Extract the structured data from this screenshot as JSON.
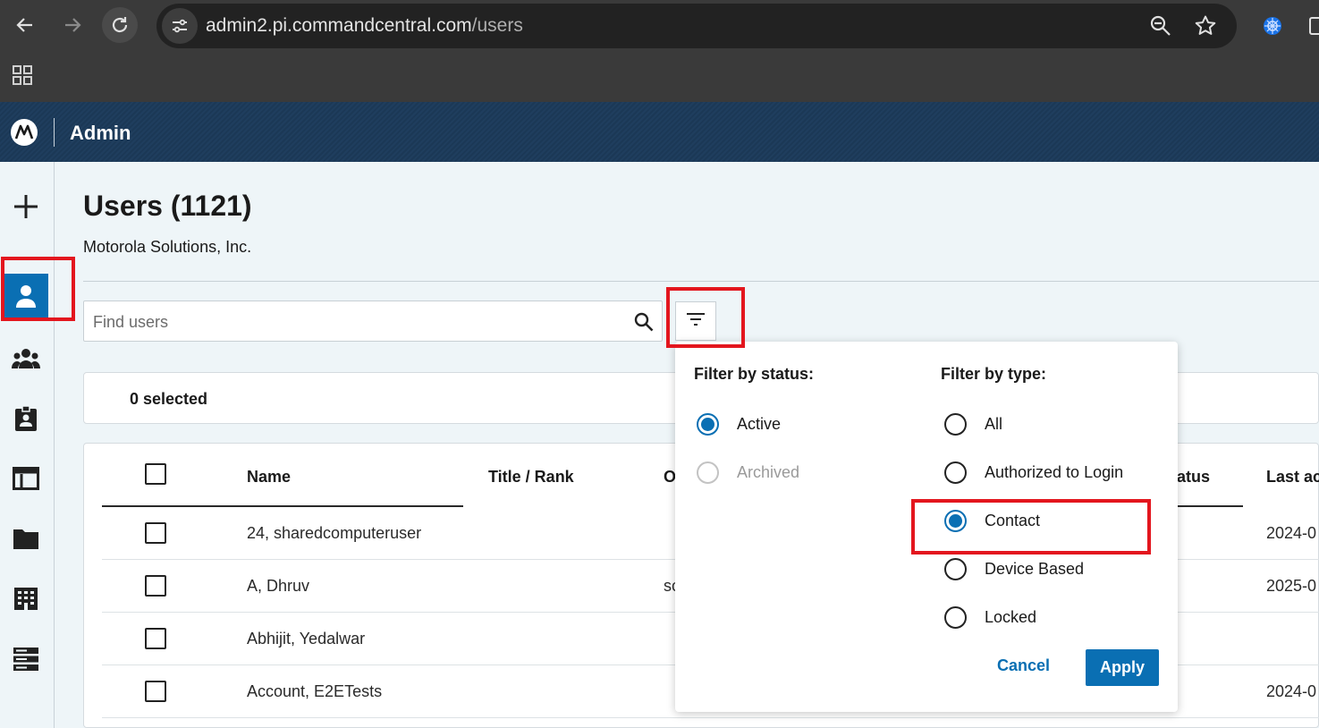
{
  "browser": {
    "url_host": "admin2.pi.commandcentral.com",
    "url_path": "/users"
  },
  "app": {
    "title": "Admin"
  },
  "page": {
    "title": "Users (1121)",
    "organization": "Motorola Solutions, Inc."
  },
  "search": {
    "placeholder": "Find users",
    "value": ""
  },
  "selection": {
    "count_label": "0 selected"
  },
  "table": {
    "headers": {
      "name": "Name",
      "title_rank": "Title / Rank",
      "o": "O",
      "status": "tatus",
      "last": "Last ac"
    },
    "rows": [
      {
        "name": "24, sharedcomputeruser",
        "o": "",
        "last": "2024-0"
      },
      {
        "name": "A, Dhruv",
        "o": "sc",
        "last": "2025-0"
      },
      {
        "name": "Abhijit, Yedalwar",
        "o": "",
        "last": ""
      },
      {
        "name": "Account, E2ETests",
        "o": "",
        "last": "2024-0"
      }
    ]
  },
  "filter": {
    "status_heading": "Filter by status:",
    "status_options": [
      {
        "label": "Active",
        "checked": true,
        "disabled": false
      },
      {
        "label": "Archived",
        "checked": false,
        "disabled": true
      }
    ],
    "type_heading": "Filter by type:",
    "type_options": [
      {
        "label": "All",
        "checked": false
      },
      {
        "label": "Authorized to Login",
        "checked": false
      },
      {
        "label": "Contact",
        "checked": true
      },
      {
        "label": "Device Based",
        "checked": false
      },
      {
        "label": "Locked",
        "checked": false
      }
    ],
    "cancel_label": "Cancel",
    "apply_label": "Apply"
  },
  "colors": {
    "accent": "#0a6fb3",
    "highlight": "#e3161e",
    "header": "#1f3e5e"
  }
}
